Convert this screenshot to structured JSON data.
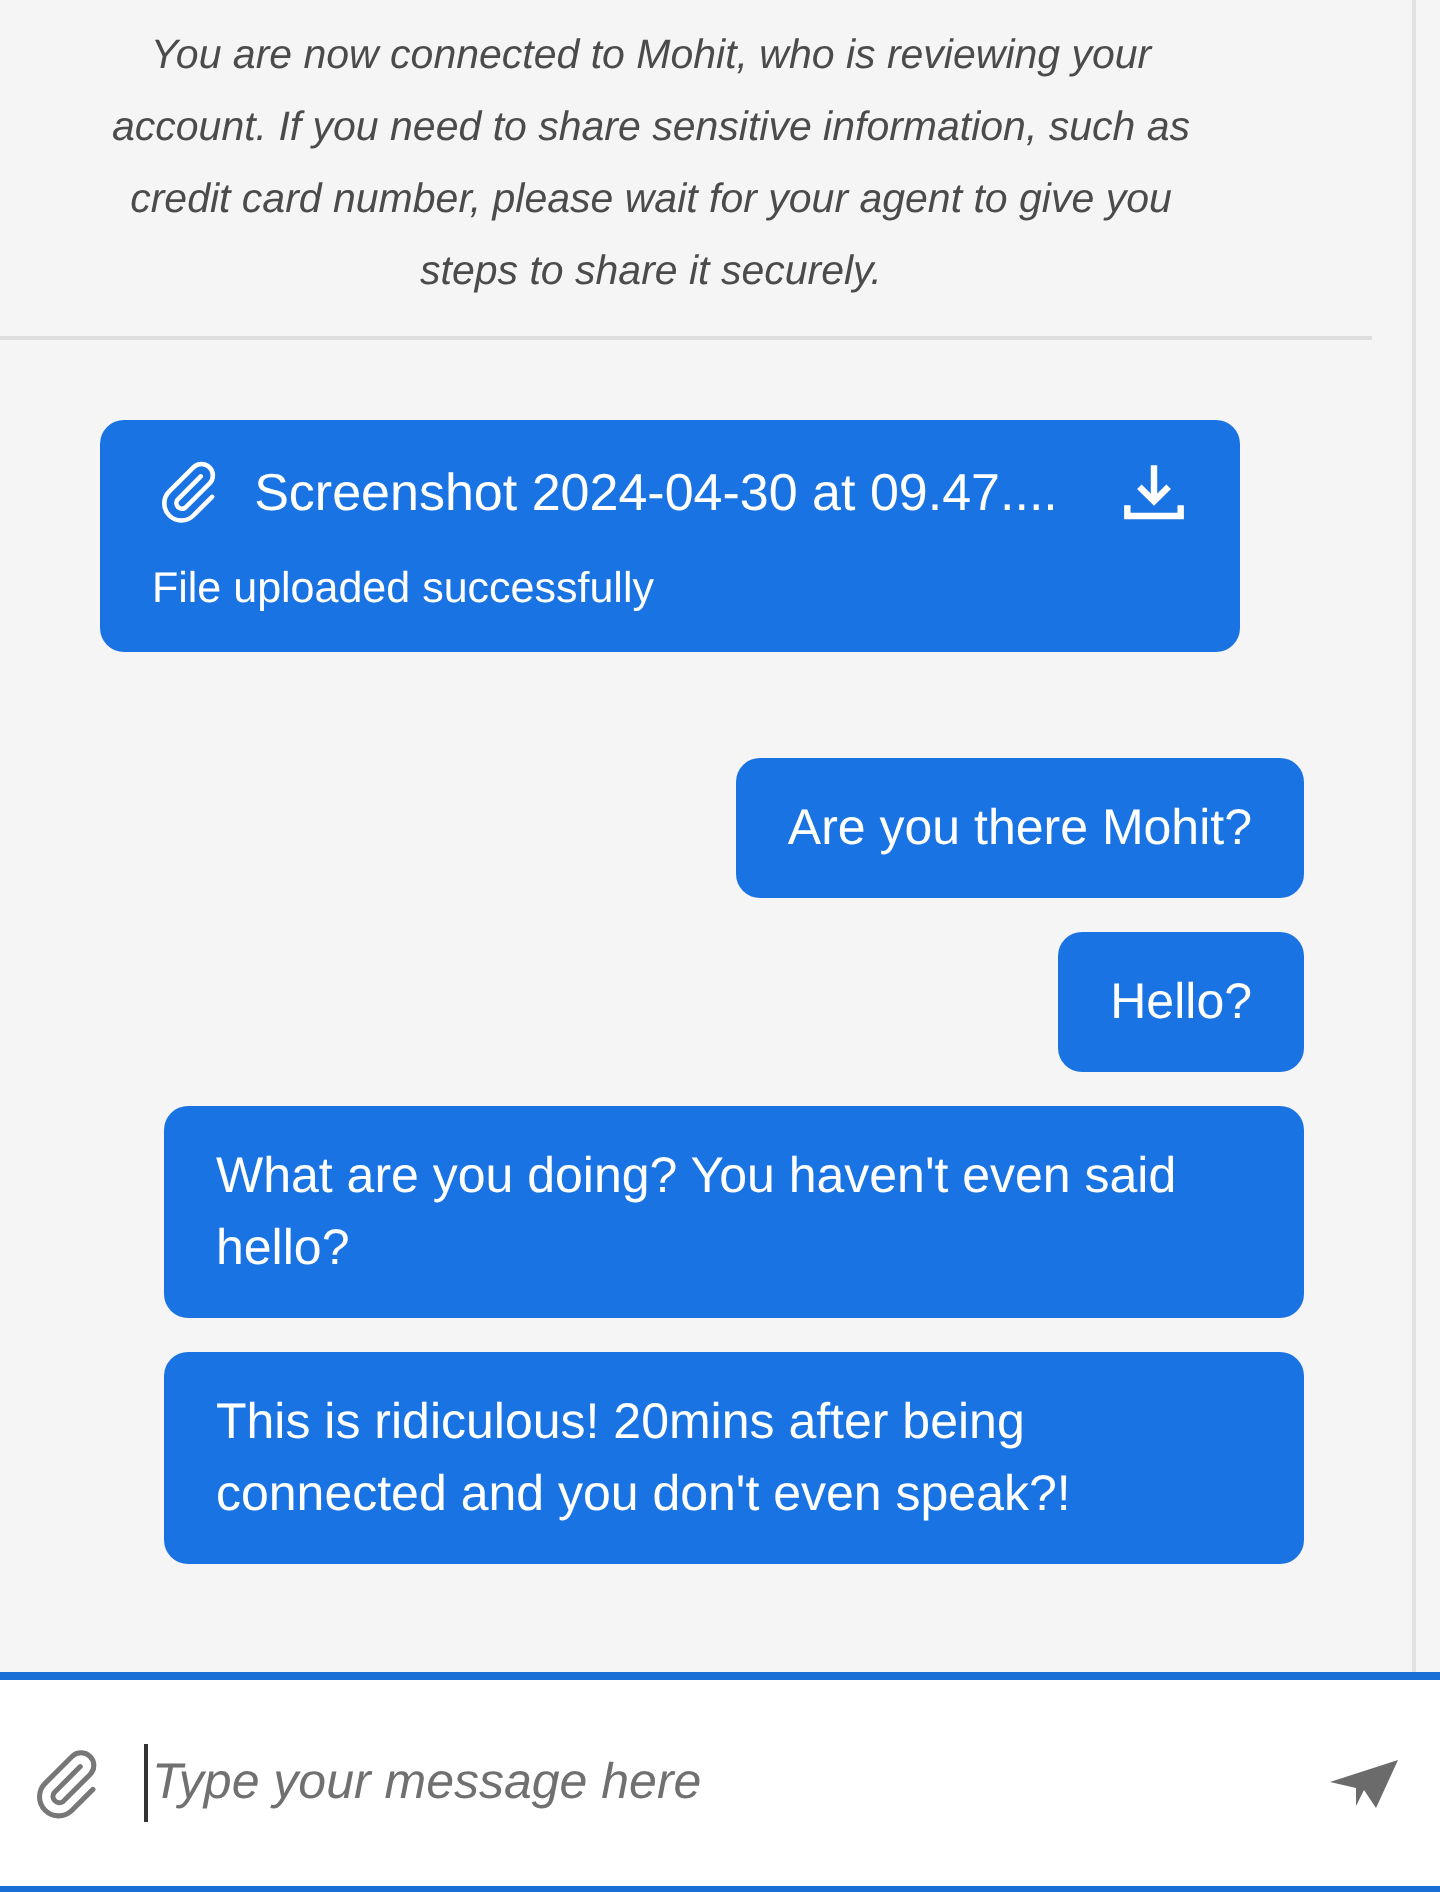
{
  "notice": "You are now connected to Mohit, who is reviewing your account. If you need to share sensitive information, such as credit card number, please wait for your agent to give you steps to share it securely.",
  "messages": [
    {
      "kind": "file",
      "file_name": "Screenshot 2024-04-30 at 09.47....",
      "status": "File uploaded successfully"
    },
    {
      "kind": "text",
      "text": "Are you there Mohit?"
    },
    {
      "kind": "text",
      "text": "Hello?"
    },
    {
      "kind": "text",
      "text": "What are you doing? You haven't even said hello?"
    },
    {
      "kind": "text",
      "text": "This is ridiculous! 20mins after being connected and you don't even speak?!"
    }
  ],
  "composer": {
    "placeholder": "Type your message here"
  }
}
